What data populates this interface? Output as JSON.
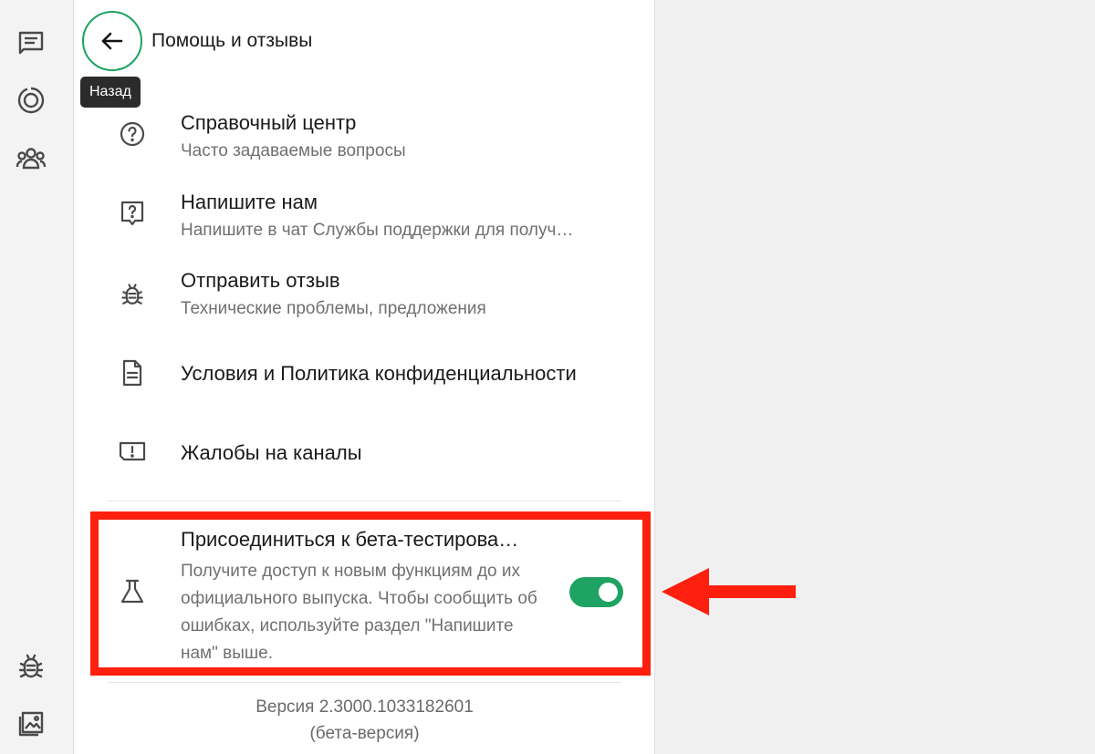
{
  "header": {
    "title": "Помощь и отзывы",
    "back_tooltip": "Назад",
    "back_icon": "arrow-left-icon"
  },
  "rail": {
    "top_icons": [
      "chats-icon",
      "status-icon",
      "communities-icon"
    ],
    "bottom_icons": [
      "bug-icon",
      "gallery-icon"
    ]
  },
  "menu": [
    {
      "title": "Справочный центр",
      "subtitle": "Часто задаваемые вопросы",
      "icon": "help-circle-icon"
    },
    {
      "title": "Напишите нам",
      "subtitle": "Напишите в чат Службы поддержки для получ…",
      "icon": "chat-question-icon"
    },
    {
      "title": "Отправить отзыв",
      "subtitle": "Технические проблемы, предложения",
      "icon": "bug-icon"
    },
    {
      "title": "Условия и Политика конфиденциальности",
      "icon": "document-icon"
    },
    {
      "title": "Жалобы на каналы",
      "icon": "report-channel-icon"
    }
  ],
  "beta": {
    "title": "Присоединиться к бета-тестирова…",
    "description": "Получите доступ к новым функциям до их официального выпуска. Чтобы сообщить об ошибках, используйте раздел \"Напишите нам\" выше.",
    "icon": "flask-icon",
    "enabled": true
  },
  "version": {
    "line1": "Версия 2.3000.1033182601",
    "line2": "(бета-версия)"
  },
  "colors": {
    "accent": "#1ea362",
    "highlight": "#ff1f0f"
  }
}
